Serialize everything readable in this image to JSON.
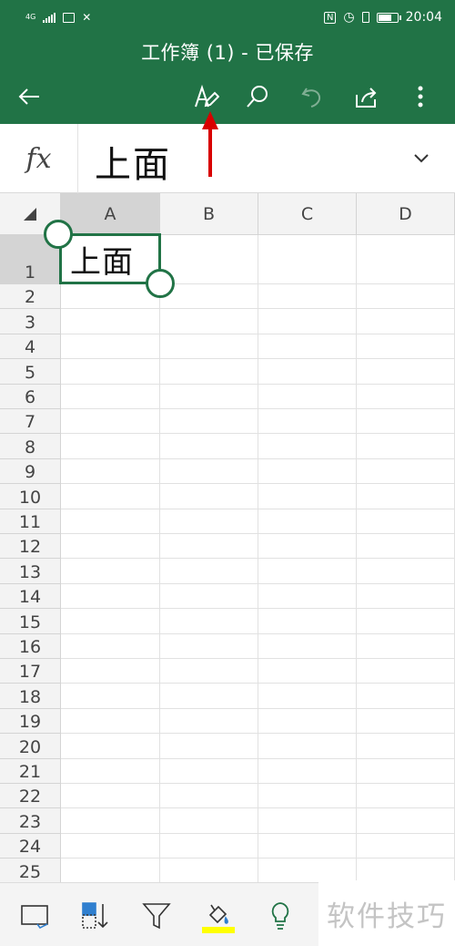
{
  "status_bar": {
    "network_label": "4G",
    "nfc_label": "N",
    "time": "20:04",
    "battery_level": 0.75
  },
  "header": {
    "title": "工作簿 (1) - 已保存",
    "back_icon": "arrow-left-icon",
    "edit_icon": "pen-icon",
    "search_icon": "search-icon",
    "undo_icon": "undo-icon",
    "share_icon": "share-icon",
    "more_icon": "more-vertical-icon"
  },
  "formula_bar": {
    "fx_label": "fx",
    "value": "上面"
  },
  "grid": {
    "columns": [
      "A",
      "B",
      "C",
      "D"
    ],
    "selected_column": "A",
    "rows": [
      "1",
      "2",
      "3",
      "4",
      "5",
      "6",
      "7",
      "8",
      "9",
      "10",
      "11",
      "12",
      "13",
      "14",
      "15",
      "16",
      "17",
      "18",
      "19",
      "20",
      "21",
      "22",
      "23",
      "24",
      "25"
    ],
    "selected_row": "1",
    "cells": {
      "A1": "上面"
    }
  },
  "bottom_toolbar": {
    "items": [
      {
        "name": "cell-format-icon"
      },
      {
        "name": "sort-icon"
      },
      {
        "name": "filter-icon"
      },
      {
        "name": "fill-color-icon",
        "indicator_color": "#ffff00"
      },
      {
        "name": "tell-me-lightbulb-icon"
      }
    ]
  },
  "watermark": {
    "text": "软件技巧"
  },
  "colors": {
    "brand": "#217346",
    "selection_border": "#217346",
    "annotation_arrow": "#d80000",
    "highlight": "#ffff00"
  }
}
